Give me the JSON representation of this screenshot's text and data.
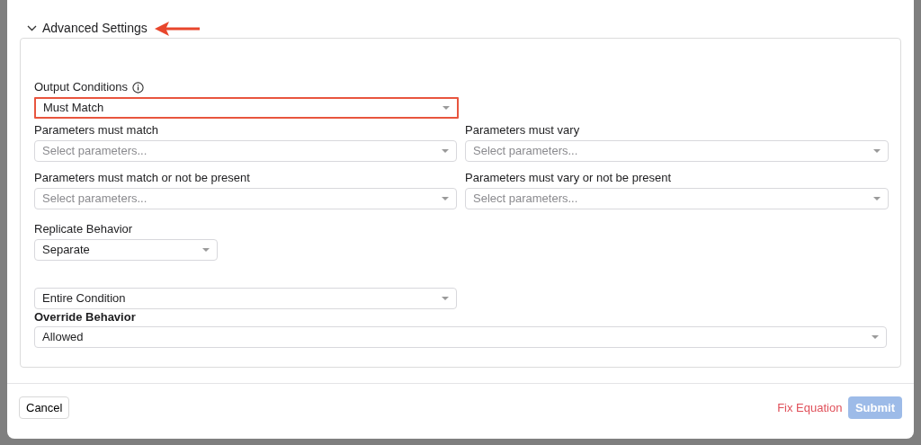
{
  "section": {
    "title": "Advanced Settings",
    "expanded": true,
    "annotated": true
  },
  "output_conditions": {
    "label": "Output Conditions",
    "value": "Must Match",
    "highlighted": true
  },
  "parameter_fields": [
    {
      "label": "Parameters must match",
      "placeholder": "Select parameters..."
    },
    {
      "label": "Parameters must vary",
      "placeholder": "Select parameters..."
    },
    {
      "label": "Parameters must match or not be present",
      "placeholder": "Select parameters..."
    },
    {
      "label": "Parameters must vary or not be present",
      "placeholder": "Select parameters..."
    }
  ],
  "replicate_behavior": {
    "label": "Replicate Behavior",
    "value": "Separate"
  },
  "scope": {
    "value": "Entire Condition"
  },
  "override_behavior": {
    "label": "Override Behavior",
    "value": "Allowed"
  },
  "footer": {
    "cancel": "Cancel",
    "fix_equation": "Fix Equation",
    "submit": "Submit",
    "submit_disabled": true
  }
}
